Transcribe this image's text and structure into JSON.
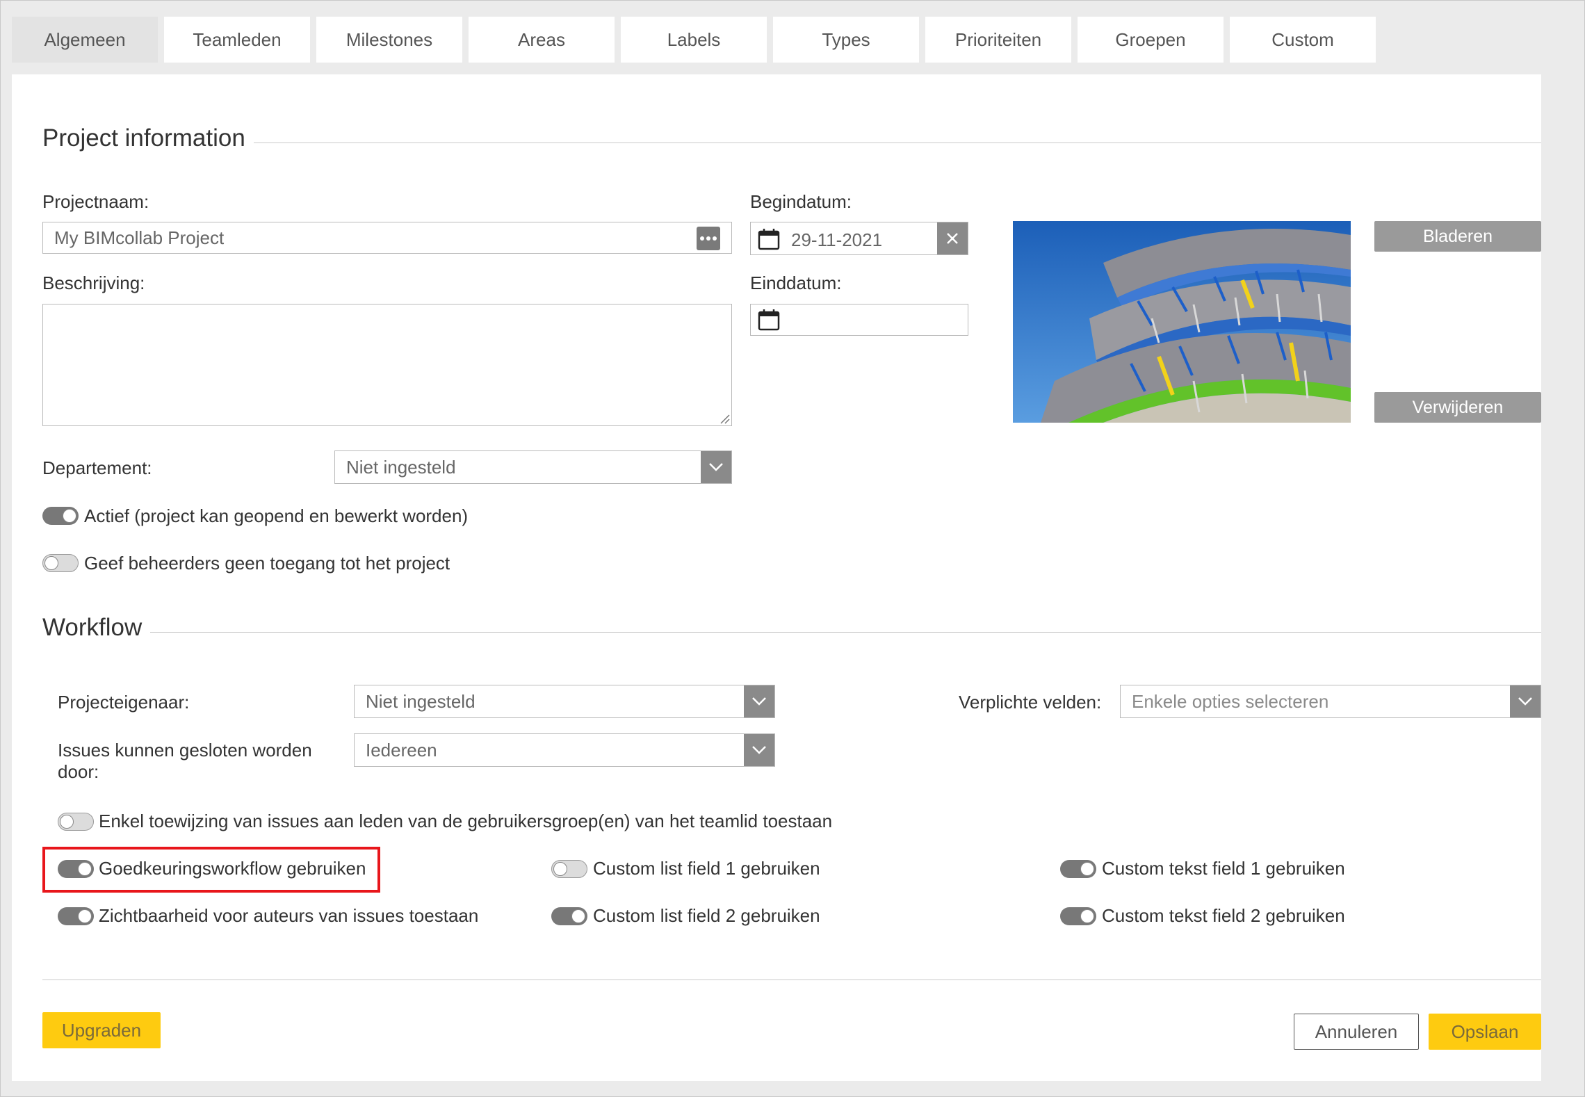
{
  "tabs": [
    {
      "label": "Algemeen",
      "active": true
    },
    {
      "label": "Teamleden",
      "active": false
    },
    {
      "label": "Milestones",
      "active": false
    },
    {
      "label": "Areas",
      "active": false
    },
    {
      "label": "Labels",
      "active": false
    },
    {
      "label": "Types",
      "active": false
    },
    {
      "label": "Prioriteiten",
      "active": false
    },
    {
      "label": "Groepen",
      "active": false
    },
    {
      "label": "Custom",
      "active": false
    }
  ],
  "project_info": {
    "title": "Project information",
    "name_label": "Projectnaam:",
    "name_value": "My BIMcollab Project",
    "description_label": "Beschrijving:",
    "description_value": "",
    "start_label": "Begindatum:",
    "start_value": "29-11-2021",
    "end_label": "Einddatum:",
    "end_value": "",
    "browse_button": "Bladeren",
    "remove_button": "Verwijderen",
    "department_label": "Departement:",
    "department_value": "Niet ingesteld",
    "active_toggle": {
      "label": "Actief (project kan geopend en bewerkt worden)",
      "on": true
    },
    "admin_toggle": {
      "label": "Geef beheerders geen toegang tot het project",
      "on": false
    }
  },
  "workflow": {
    "title": "Workflow",
    "owner_label": "Projecteigenaar:",
    "owner_value": "Niet ingesteld",
    "closers_label_line1": "Issues kunnen gesloten worden",
    "closers_label_line2": "door:",
    "closers_value": "Iedereen",
    "required_label": "Verplichte velden:",
    "required_placeholder": "Enkele opties selecteren",
    "assign_toggle": {
      "label": "Enkel toewijzing van issues aan leden van de gebruikersgroep(en) van het teamlid toestaan",
      "on": false
    },
    "approval_toggle": {
      "label": "Goedkeuringsworkflow gebruiken",
      "on": true
    },
    "visibility_toggle": {
      "label": "Zichtbaarheid voor auteurs van issues toestaan",
      "on": true
    },
    "custom_list1_toggle": {
      "label": "Custom list field 1 gebruiken",
      "on": false
    },
    "custom_list2_toggle": {
      "label": "Custom list field 2 gebruiken",
      "on": true
    },
    "custom_text1_toggle": {
      "label": "Custom tekst field 1 gebruiken",
      "on": true
    },
    "custom_text2_toggle": {
      "label": "Custom tekst field 2 gebruiken",
      "on": true
    }
  },
  "footer": {
    "upgrade_button": "Upgraden",
    "cancel_button": "Annuleren",
    "save_button": "Opslaan"
  },
  "colors": {
    "accent_yellow": "#fecb10",
    "highlight_red": "#e8161b",
    "toggle_on": "#787878"
  }
}
